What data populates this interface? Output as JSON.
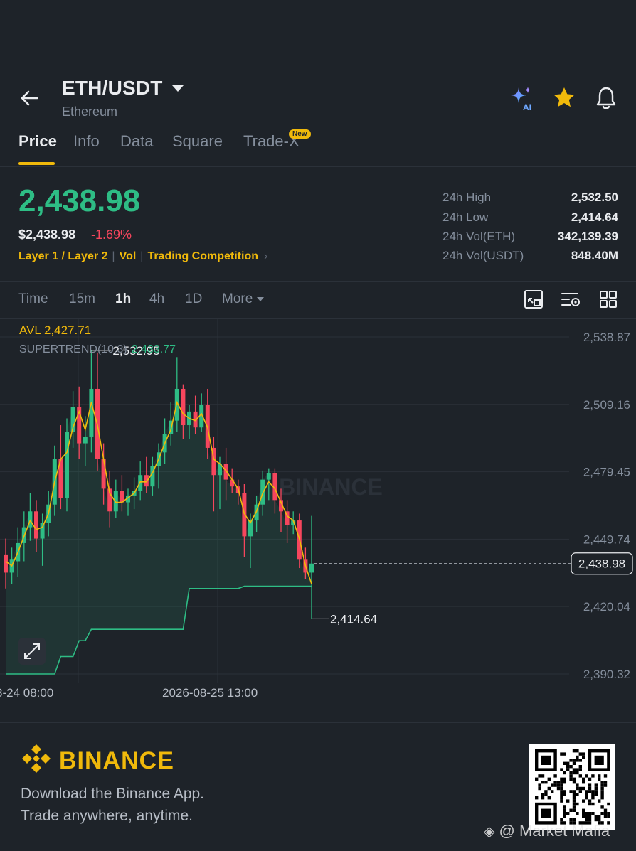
{
  "header": {
    "pair": "ETH/USDT",
    "name": "Ethereum",
    "ai_badge": "AI",
    "icons": [
      "back-arrow-icon",
      "chevron-down-icon",
      "ai-sparkle-icon",
      "star-icon",
      "bell-icon"
    ]
  },
  "tabs": [
    {
      "label": "Price",
      "active": true
    },
    {
      "label": "Info",
      "active": false
    },
    {
      "label": "Data",
      "active": false
    },
    {
      "label": "Square",
      "active": false
    },
    {
      "label": "Trade-X",
      "active": false,
      "badge": "New"
    }
  ],
  "price": {
    "last": "2,438.98",
    "usd": "$2,438.98",
    "change": "-1.69%"
  },
  "tags": {
    "category": "Layer 1 / Layer 2",
    "vol": "Vol",
    "campaign": "Trading Competition"
  },
  "stats": [
    {
      "label": "24h High",
      "value": "2,532.50"
    },
    {
      "label": "24h Low",
      "value": "2,414.64"
    },
    {
      "label": "24h Vol(ETH)",
      "value": "342,139.39"
    },
    {
      "label": "24h Vol(USDT)",
      "value": "848.40M"
    }
  ],
  "intervals": [
    {
      "label": "Time",
      "active": false
    },
    {
      "label": "15m",
      "active": false
    },
    {
      "label": "1h",
      "active": true
    },
    {
      "label": "4h",
      "active": false
    },
    {
      "label": "1D",
      "active": false
    },
    {
      "label": "More",
      "active": false
    }
  ],
  "chart_data": {
    "type": "candlestick",
    "indicators": {
      "avl_label": "AVL 2,427.71",
      "supertrend_label": "SUPERTREND(10,3)",
      "supertrend_value": "2,433.77"
    },
    "ylim": [
      2390.32,
      2538.87
    ],
    "y_ticks": [
      "2,538.87",
      "2,509.16",
      "2,479.45",
      "2,449.74",
      "2,420.04",
      "2,390.32"
    ],
    "y_tick_values": [
      2538.87,
      2509.16,
      2479.45,
      2449.74,
      2420.04,
      2390.32
    ],
    "x_ticks": [
      "8-24 08:00",
      "2026-08-25 13:00"
    ],
    "high_marker": {
      "label": "2,532.95",
      "value": 2532.95
    },
    "low_marker": {
      "label": "2,414.64",
      "value": 2414.64
    },
    "last_price": {
      "label": "2,438.98",
      "value": 2438.98
    },
    "watermark": "BINANCE",
    "candles": [
      {
        "o": 2443,
        "h": 2450,
        "l": 2428,
        "c": 2435
      },
      {
        "o": 2435,
        "h": 2446,
        "l": 2430,
        "c": 2441
      },
      {
        "o": 2440,
        "h": 2455,
        "l": 2433,
        "c": 2448
      },
      {
        "o": 2448,
        "h": 2462,
        "l": 2440,
        "c": 2455
      },
      {
        "o": 2455,
        "h": 2470,
        "l": 2449,
        "c": 2462
      },
      {
        "o": 2462,
        "h": 2467,
        "l": 2444,
        "c": 2450
      },
      {
        "o": 2450,
        "h": 2461,
        "l": 2438,
        "c": 2457
      },
      {
        "o": 2457,
        "h": 2471,
        "l": 2451,
        "c": 2465
      },
      {
        "o": 2465,
        "h": 2491,
        "l": 2460,
        "c": 2485
      },
      {
        "o": 2485,
        "h": 2500,
        "l": 2463,
        "c": 2468
      },
      {
        "o": 2468,
        "h": 2503,
        "l": 2462,
        "c": 2497
      },
      {
        "o": 2497,
        "h": 2515,
        "l": 2490,
        "c": 2508
      },
      {
        "o": 2508,
        "h": 2517,
        "l": 2485,
        "c": 2492
      },
      {
        "o": 2492,
        "h": 2504,
        "l": 2482,
        "c": 2495
      },
      {
        "o": 2495,
        "h": 2532.95,
        "l": 2488,
        "c": 2516
      },
      {
        "o": 2516,
        "h": 2532,
        "l": 2480,
        "c": 2485
      },
      {
        "o": 2485,
        "h": 2492,
        "l": 2465,
        "c": 2472
      },
      {
        "o": 2472,
        "h": 2480,
        "l": 2455,
        "c": 2462
      },
      {
        "o": 2462,
        "h": 2476,
        "l": 2459,
        "c": 2471
      },
      {
        "o": 2471,
        "h": 2478,
        "l": 2462,
        "c": 2466
      },
      {
        "o": 2466,
        "h": 2472,
        "l": 2460,
        "c": 2469
      },
      {
        "o": 2469,
        "h": 2477,
        "l": 2463,
        "c": 2471
      },
      {
        "o": 2471,
        "h": 2484,
        "l": 2467,
        "c": 2478
      },
      {
        "o": 2478,
        "h": 2486,
        "l": 2470,
        "c": 2473
      },
      {
        "o": 2473,
        "h": 2486,
        "l": 2469,
        "c": 2482
      },
      {
        "o": 2482,
        "h": 2492,
        "l": 2472,
        "c": 2488
      },
      {
        "o": 2488,
        "h": 2503,
        "l": 2483,
        "c": 2496
      },
      {
        "o": 2496,
        "h": 2510,
        "l": 2491,
        "c": 2502
      },
      {
        "o": 2502,
        "h": 2530,
        "l": 2497,
        "c": 2516
      },
      {
        "o": 2516,
        "h": 2518,
        "l": 2494,
        "c": 2500
      },
      {
        "o": 2500,
        "h": 2509,
        "l": 2494,
        "c": 2506
      },
      {
        "o": 2506,
        "h": 2513,
        "l": 2496,
        "c": 2499
      },
      {
        "o": 2499,
        "h": 2514,
        "l": 2497,
        "c": 2509
      },
      {
        "o": 2509,
        "h": 2516,
        "l": 2485,
        "c": 2490
      },
      {
        "o": 2490,
        "h": 2495,
        "l": 2462,
        "c": 2478
      },
      {
        "o": 2478,
        "h": 2486,
        "l": 2463,
        "c": 2483
      },
      {
        "o": 2483,
        "h": 2490,
        "l": 2467,
        "c": 2476
      },
      {
        "o": 2476,
        "h": 2481,
        "l": 2470,
        "c": 2473
      },
      {
        "o": 2473,
        "h": 2476,
        "l": 2465,
        "c": 2470
      },
      {
        "o": 2470,
        "h": 2474,
        "l": 2442,
        "c": 2451
      },
      {
        "o": 2451,
        "h": 2461,
        "l": 2437,
        "c": 2458
      },
      {
        "o": 2458,
        "h": 2469,
        "l": 2453,
        "c": 2465
      },
      {
        "o": 2465,
        "h": 2480,
        "l": 2460,
        "c": 2476
      },
      {
        "o": 2476,
        "h": 2481,
        "l": 2467,
        "c": 2479
      },
      {
        "o": 2479,
        "h": 2481,
        "l": 2461,
        "c": 2467
      },
      {
        "o": 2467,
        "h": 2472,
        "l": 2453,
        "c": 2462
      },
      {
        "o": 2462,
        "h": 2467,
        "l": 2448,
        "c": 2456
      },
      {
        "o": 2456,
        "h": 2462,
        "l": 2452,
        "c": 2458
      },
      {
        "o": 2458,
        "h": 2461,
        "l": 2437,
        "c": 2441
      },
      {
        "o": 2441,
        "h": 2446,
        "l": 2432,
        "c": 2435
      },
      {
        "o": 2435,
        "h": 2460,
        "l": 2414.64,
        "c": 2438.98
      }
    ],
    "avl_series": [
      2440,
      2438,
      2444,
      2451,
      2458,
      2454,
      2455,
      2461,
      2475,
      2485,
      2488,
      2499,
      2506,
      2498,
      2510,
      2500,
      2485,
      2470,
      2466,
      2466,
      2468,
      2470,
      2475,
      2475,
      2479,
      2485,
      2492,
      2498,
      2510,
      2505,
      2503,
      2502,
      2505,
      2499,
      2485,
      2483,
      2480,
      2476,
      2472,
      2461,
      2457,
      2462,
      2470,
      2475,
      2472,
      2466,
      2460,
      2458,
      2450,
      2438,
      2430
    ],
    "supertrend_series": [
      2390.32,
      2390.32,
      2390.32,
      2390.32,
      2390.32,
      2390.32,
      2390.32,
      2390.32,
      2390.32,
      2398,
      2398,
      2398,
      2405,
      2405,
      2410,
      2410,
      2410,
      2410,
      2410,
      2410,
      2410,
      2410,
      2410,
      2410,
      2410,
      2410,
      2410,
      2410,
      2410,
      2410,
      2428,
      2428,
      2428,
      2428,
      2428,
      2428,
      2428,
      2428,
      2428,
      2429,
      2429,
      2429,
      2429,
      2429,
      2429,
      2429,
      2429,
      2429,
      2429,
      2429,
      2429
    ],
    "colors": {
      "up": "#2ebd85",
      "down": "#f6465d",
      "avl": "#f0b90b",
      "supertrend": "#2ebd85"
    }
  },
  "footer": {
    "brand": "BINANCE",
    "line1": "Download the Binance App.",
    "line2": "Trade anywhere, anytime.",
    "watermark": "@ Market Mafia"
  },
  "colors": {
    "background": "#1e2329",
    "accent": "#f0b90b",
    "up": "#2ebd85",
    "down": "#f6465d",
    "text_secondary": "#848e9c"
  }
}
